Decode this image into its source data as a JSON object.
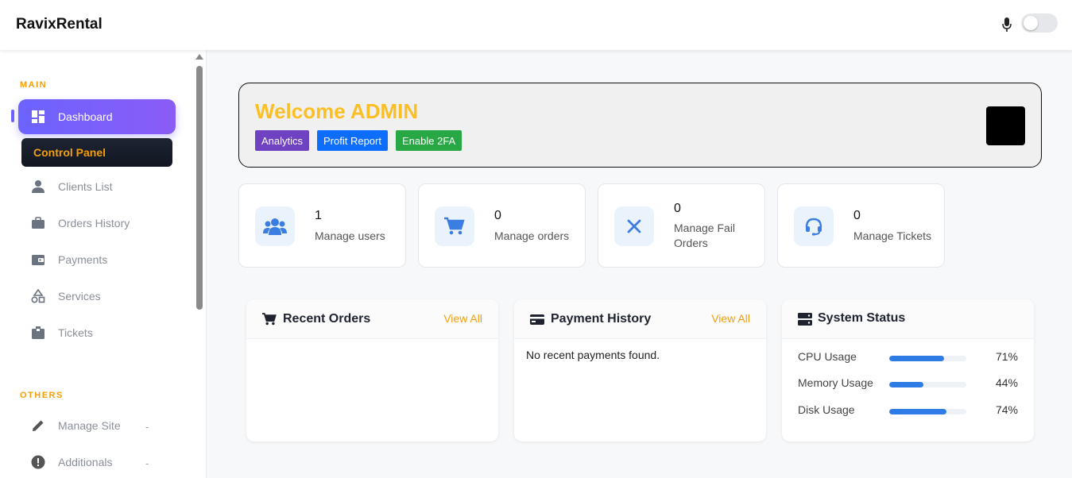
{
  "app": {
    "brand": "RavixRental"
  },
  "sidebar": {
    "section_main": "MAIN",
    "section_others": "OTHERS",
    "dashboard": "Dashboard",
    "control_panel": "Control Panel",
    "items": [
      {
        "label": "Clients List",
        "icon": "user-icon"
      },
      {
        "label": "Orders History",
        "icon": "briefcase-icon"
      },
      {
        "label": "Payments",
        "icon": "wallet-icon"
      },
      {
        "label": "Services",
        "icon": "shapes-icon"
      },
      {
        "label": "Tickets",
        "icon": "box-icon"
      }
    ],
    "others": [
      {
        "label": "Manage Site",
        "tag": "-",
        "icon": "pencil-icon"
      },
      {
        "label": "Additionals",
        "tag": "-",
        "icon": "alert-circle-icon"
      }
    ]
  },
  "welcome": {
    "title": "Welcome ADMIN",
    "buttons": {
      "analytics": "Analytics",
      "profit": "Profit Report",
      "twofa": "Enable 2FA"
    }
  },
  "stats": [
    {
      "value": "1",
      "label": "Manage users",
      "icon": "users-icon"
    },
    {
      "value": "0",
      "label": "Manage orders",
      "icon": "cart-icon"
    },
    {
      "value": "0",
      "label": "Manage Fail Orders",
      "icon": "x-icon"
    },
    {
      "value": "0",
      "label": "Manage Tickets",
      "icon": "headset-icon"
    }
  ],
  "panels": {
    "recent_orders": {
      "title": "Recent Orders",
      "view_all": "View All"
    },
    "payment_history": {
      "title": "Payment History",
      "view_all": "View All",
      "empty": "No recent payments found."
    },
    "system_status": {
      "title": "System Status",
      "rows": [
        {
          "label": "CPU Usage",
          "percent": 71,
          "text": "71%"
        },
        {
          "label": "Memory Usage",
          "percent": 44,
          "text": "44%"
        },
        {
          "label": "Disk Usage",
          "percent": 74,
          "text": "74%"
        }
      ]
    }
  },
  "colors": {
    "accent": "#6c63ff",
    "orange": "#f59e0b",
    "welcome_title": "#fbbf24",
    "progress": "#2f7be5",
    "icon_blue": "#3b7de0"
  }
}
